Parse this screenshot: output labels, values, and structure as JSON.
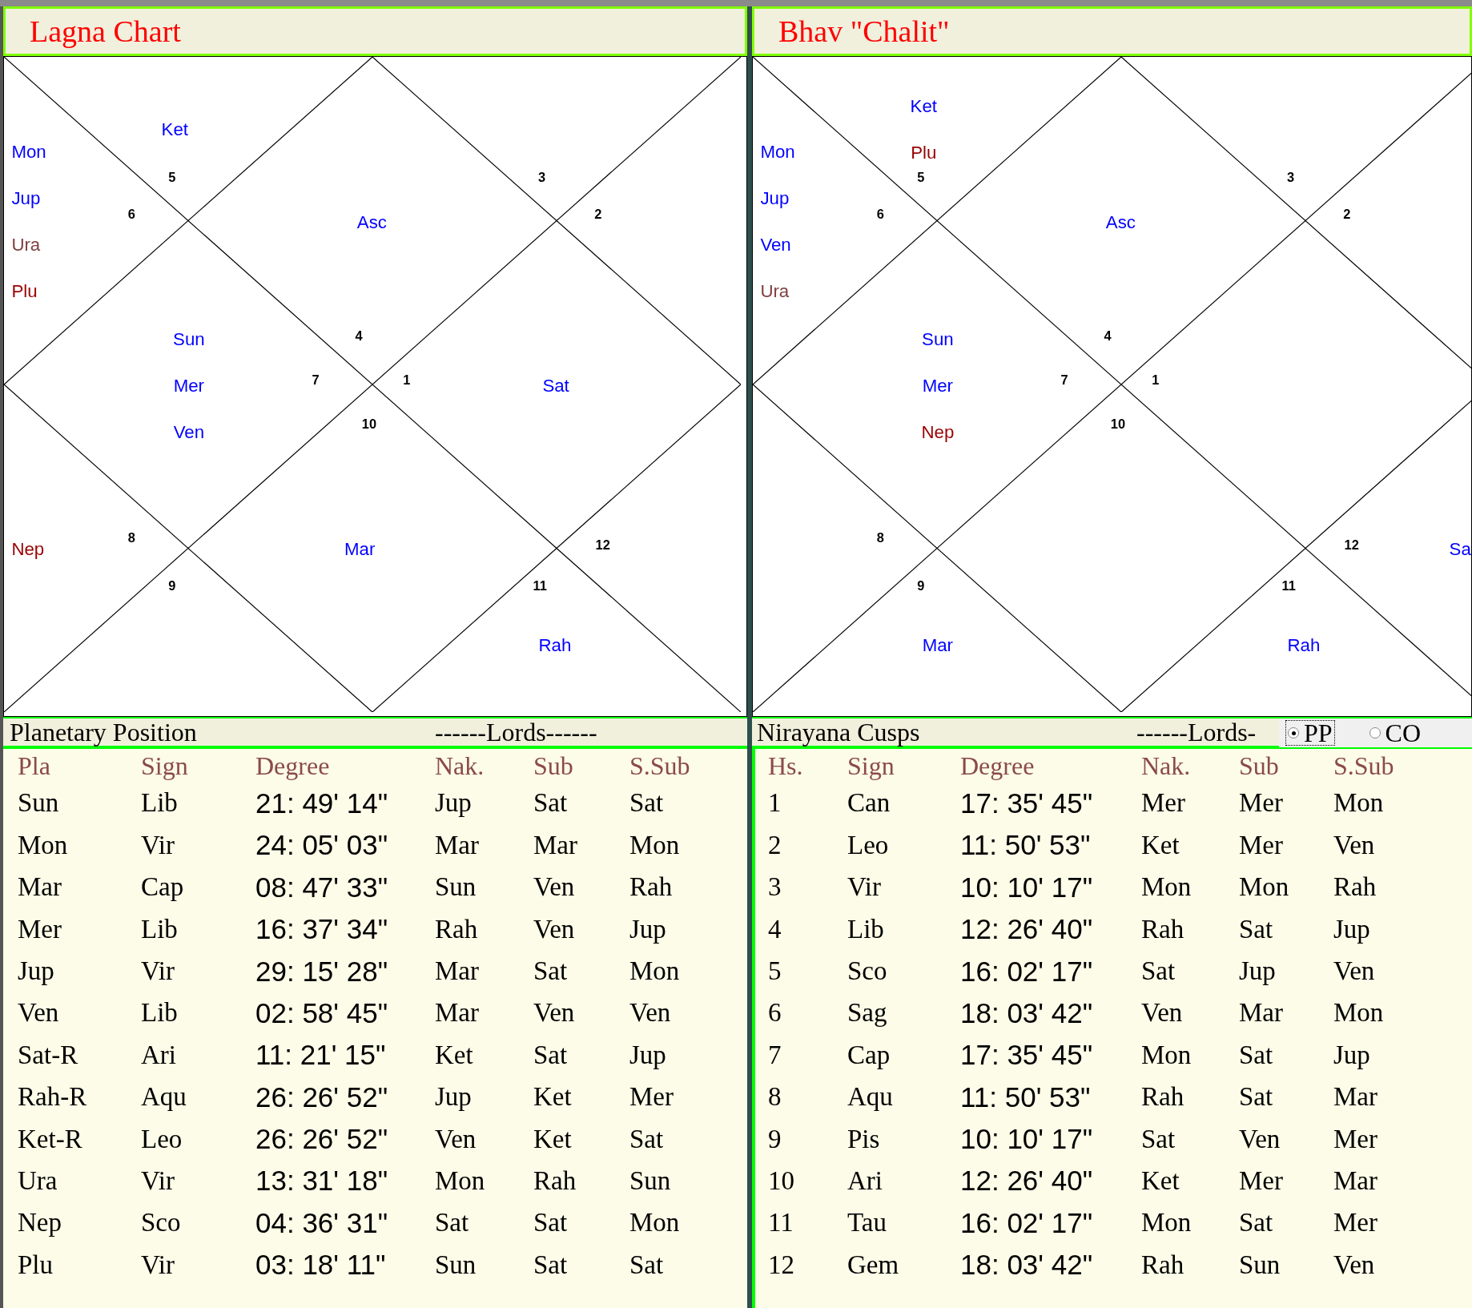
{
  "charts": [
    {
      "title": "Lagna Chart",
      "houses": [
        {
          "sign": "4",
          "planets": [
            {
              "name": "Asc",
              "color": "#0000ff"
            }
          ]
        },
        {
          "sign": "5",
          "planets": [
            {
              "name": "Ket",
              "color": "#0000ff"
            }
          ]
        },
        {
          "sign": "6",
          "planets": [
            {
              "name": "Mon",
              "color": "#0000ff"
            },
            {
              "name": "Jup",
              "color": "#0000ff"
            },
            {
              "name": "Ura",
              "color": "#804040"
            },
            {
              "name": "Plu",
              "color": "#990000"
            }
          ]
        },
        {
          "sign": "7",
          "planets": [
            {
              "name": "Sun",
              "color": "#0000ff"
            },
            {
              "name": "Mer",
              "color": "#0000ff"
            },
            {
              "name": "Ven",
              "color": "#0000ff"
            }
          ]
        },
        {
          "sign": "8",
          "planets": [
            {
              "name": "Nep",
              "color": "#990000"
            }
          ]
        },
        {
          "sign": "9"
        },
        {
          "sign": "10",
          "planets": [
            {
              "name": "Mar",
              "color": "#0000ff"
            }
          ]
        },
        {
          "sign": "11",
          "planets": [
            {
              "name": "Rah",
              "color": "#0000ff"
            }
          ]
        },
        {
          "sign": "12"
        },
        {
          "sign": "1",
          "planets": [
            {
              "name": "Sat",
              "color": "#0000ff"
            }
          ]
        },
        {
          "sign": "2"
        },
        {
          "sign": "3"
        }
      ]
    },
    {
      "title": "Bhav \"Chalit\"",
      "houses": [
        {
          "sign": "4",
          "planets": [
            {
              "name": "Asc",
              "color": "#0000ff"
            }
          ]
        },
        {
          "sign": "5",
          "planets": [
            {
              "name": "Ket",
              "color": "#0000ff"
            },
            {
              "name": "Plu",
              "color": "#990000"
            }
          ]
        },
        {
          "sign": "6",
          "planets": [
            {
              "name": "Mon",
              "color": "#0000ff"
            },
            {
              "name": "Jup",
              "color": "#0000ff"
            },
            {
              "name": "Ven",
              "color": "#0000ff"
            },
            {
              "name": "Ura",
              "color": "#804040"
            }
          ]
        },
        {
          "sign": "7",
          "planets": [
            {
              "name": "Sun",
              "color": "#0000ff"
            },
            {
              "name": "Mer",
              "color": "#0000ff"
            },
            {
              "name": "Nep",
              "color": "#990000"
            }
          ]
        },
        {
          "sign": "8"
        },
        {
          "sign": "9",
          "planets": [
            {
              "name": "Mar",
              "color": "#0000ff"
            }
          ]
        },
        {
          "sign": "10"
        },
        {
          "sign": "11",
          "planets": [
            {
              "name": "Rah",
              "color": "#0000ff"
            }
          ]
        },
        {
          "sign": "12",
          "planets": [
            {
              "name": "Sa",
              "color": "#0000ff"
            }
          ]
        },
        {
          "sign": "1"
        },
        {
          "sign": "2"
        },
        {
          "sign": "3"
        }
      ]
    }
  ],
  "tables": [
    {
      "title": "Planetary Position",
      "lords_label": "------Lords------",
      "columns": [
        "Pla",
        "Sign",
        "Degree",
        "Nak.",
        "Sub",
        "S.Sub"
      ],
      "rows": [
        [
          "Sun",
          "Lib",
          "21: 49' 14\"",
          "Jup",
          "Sat",
          "Sat"
        ],
        [
          "Mon",
          "Vir",
          "24: 05' 03\"",
          "Mar",
          "Mar",
          "Mon"
        ],
        [
          "Mar",
          "Cap",
          "08: 47' 33\"",
          "Sun",
          "Ven",
          "Rah"
        ],
        [
          "Mer",
          "Lib",
          "16: 37' 34\"",
          "Rah",
          "Ven",
          "Jup"
        ],
        [
          "Jup",
          "Vir",
          "29: 15' 28\"",
          "Mar",
          "Sat",
          "Mon"
        ],
        [
          "Ven",
          "Lib",
          "02: 58' 45\"",
          "Mar",
          "Ven",
          "Ven"
        ],
        [
          "Sat-R",
          "Ari",
          "11: 21' 15\"",
          "Ket",
          "Sat",
          "Jup"
        ],
        [
          "Rah-R",
          "Aqu",
          "26: 26' 52\"",
          "Jup",
          "Ket",
          "Mer"
        ],
        [
          "Ket-R",
          "Leo",
          "26: 26' 52\"",
          "Ven",
          "Ket",
          "Sat"
        ],
        [
          "Ura",
          "Vir",
          "13: 31' 18\"",
          "Mon",
          "Rah",
          "Sun"
        ],
        [
          "Nep",
          "Sco",
          "04: 36' 31\"",
          "Sat",
          "Sat",
          "Mon"
        ],
        [
          "Plu",
          "Vir",
          "03: 18' 11\"",
          "Sun",
          "Sat",
          "Sat"
        ]
      ]
    },
    {
      "title": "Nirayana Cusps",
      "lords_label": "------Lords-",
      "columns": [
        "Hs.",
        "Sign",
        "Degree",
        "Nak.",
        "Sub",
        "S.Sub"
      ],
      "rows": [
        [
          "1",
          "Can",
          "17: 35' 45\"",
          "Mer",
          "Mer",
          "Mon"
        ],
        [
          "2",
          "Leo",
          "11: 50' 53\"",
          "Ket",
          "Mer",
          "Ven"
        ],
        [
          "3",
          "Vir",
          "10: 10' 17\"",
          "Mon",
          "Mon",
          "Rah"
        ],
        [
          "4",
          "Lib",
          "12: 26' 40\"",
          "Rah",
          "Sat",
          "Jup"
        ],
        [
          "5",
          "Sco",
          "16: 02' 17\"",
          "Sat",
          "Jup",
          "Ven"
        ],
        [
          "6",
          "Sag",
          "18: 03' 42\"",
          "Ven",
          "Mar",
          "Mon"
        ],
        [
          "7",
          "Cap",
          "17: 35' 45\"",
          "Mon",
          "Sat",
          "Jup"
        ],
        [
          "8",
          "Aqu",
          "11: 50' 53\"",
          "Rah",
          "Sat",
          "Mar"
        ],
        [
          "9",
          "Pis",
          "10: 10' 17\"",
          "Sat",
          "Ven",
          "Mer"
        ],
        [
          "10",
          "Ari",
          "12: 26' 40\"",
          "Ket",
          "Mer",
          "Mar"
        ],
        [
          "11",
          "Tau",
          "16: 02' 17\"",
          "Mon",
          "Sat",
          "Mer"
        ],
        [
          "12",
          "Gem",
          "18: 03' 42\"",
          "Rah",
          "Sun",
          "Ven"
        ]
      ]
    }
  ],
  "radio": [
    {
      "label": "PP",
      "selected": true
    },
    {
      "label": "CO",
      "selected": false
    }
  ]
}
